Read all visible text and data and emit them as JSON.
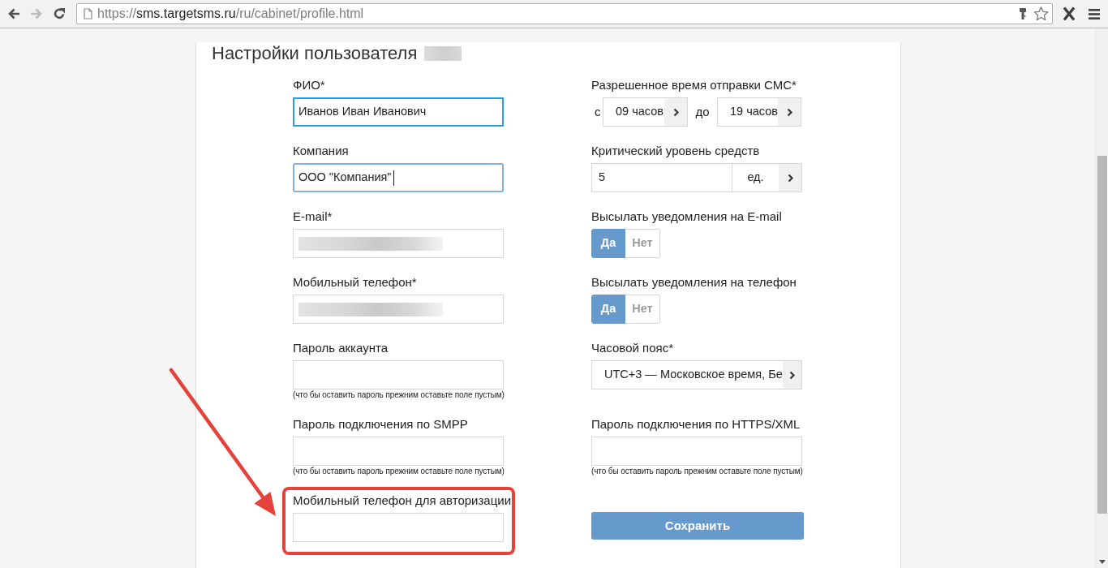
{
  "browser": {
    "nav_buttons": [
      {
        "kind": "back",
        "disabled": false
      },
      {
        "kind": "forward",
        "disabled": true
      },
      {
        "kind": "reload",
        "disabled": false
      }
    ],
    "url": {
      "scheme": "https://",
      "host": "sms.targetsms.ru",
      "path": "/ru/cabinet/profile.html"
    }
  },
  "page": {
    "title": "Настройки пользователя",
    "title_redacted": true
  },
  "left_column": [
    {
      "kind": "text",
      "label": "ФИО*",
      "value": "Иванов Иван Иванович",
      "hovered": true,
      "focused": false,
      "redacted": false,
      "highlighted": false
    },
    {
      "kind": "text",
      "label": "Компания",
      "value": "ООО \"Компания\"",
      "hovered": false,
      "focused": true,
      "redacted": false,
      "highlighted": false
    },
    {
      "kind": "text",
      "label": "E-mail*",
      "hovered": false,
      "focused": false,
      "redacted": true,
      "highlighted": false
    },
    {
      "kind": "text",
      "label": "Мобильный телефон*",
      "hovered": false,
      "focused": false,
      "redacted": true,
      "highlighted": false
    },
    {
      "kind": "text",
      "label": "Пароль аккаунта",
      "hint": "(что бы оставить пароль прежним оставьте поле пустым)",
      "hovered": false,
      "focused": false,
      "redacted": false,
      "highlighted": false
    },
    {
      "kind": "text",
      "label": "Пароль подключения по SMPP",
      "hint": "(что бы оставить пароль прежним оставьте поле пустым)",
      "hovered": false,
      "focused": false,
      "redacted": false,
      "highlighted": false
    },
    {
      "kind": "text",
      "label": "Мобильный телефон для авторизации",
      "hovered": false,
      "focused": false,
      "redacted": false,
      "highlighted": true
    }
  ],
  "right_column": [
    {
      "kind": "time_range",
      "label": "Разрешенное время отправки СМС*",
      "from_label": "с",
      "from_value": "09 часов",
      "to_label": "до",
      "to_value": "19 часов"
    },
    {
      "kind": "number_unit",
      "label": "Критический уровень средств",
      "value": "5",
      "unit": "ед."
    },
    {
      "kind": "toggle",
      "label": "Высылать уведомления на E-mail",
      "options": [
        {
          "label": "Да",
          "selected": true
        },
        {
          "label": "Нет",
          "selected": false
        }
      ]
    },
    {
      "kind": "toggle",
      "label": "Высылать уведомления на телефон",
      "options": [
        {
          "label": "Да",
          "selected": true
        },
        {
          "label": "Нет",
          "selected": false
        }
      ]
    },
    {
      "kind": "select",
      "label": "Часовой пояс*",
      "value": "UTC+3 — Московское время, Бе"
    },
    {
      "kind": "text",
      "label": "Пароль подключения по HTTPS/XML",
      "hint": "(что бы оставить пароль прежним оставьте поле пустым)",
      "hovered": false,
      "focused": false,
      "redacted": false,
      "highlighted": false
    },
    {
      "kind": "button",
      "label": "Сохранить"
    }
  ]
}
